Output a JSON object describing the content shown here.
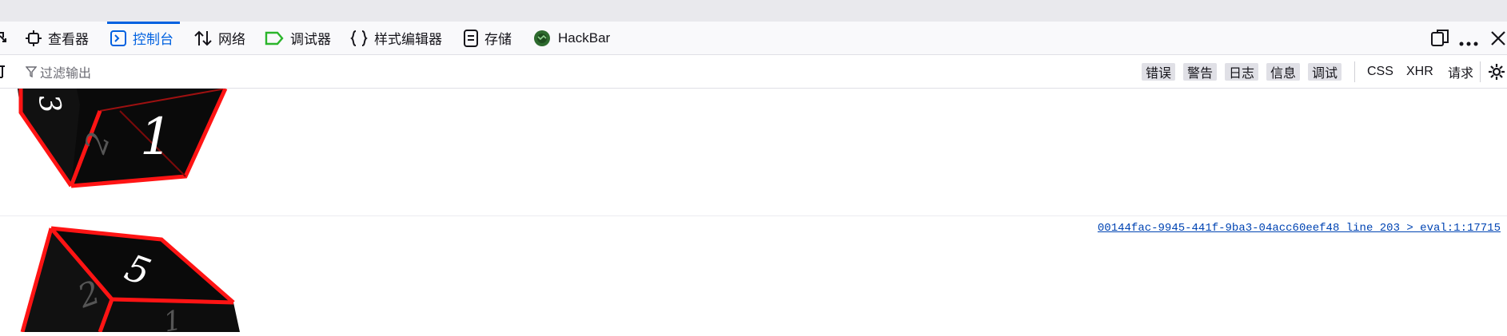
{
  "toolbar": {
    "tabs": [
      {
        "label": "查看器",
        "icon": "inspector-icon"
      },
      {
        "label": "控制台",
        "icon": "console-icon",
        "active": true
      },
      {
        "label": "网络",
        "icon": "network-icon"
      },
      {
        "label": "调试器",
        "icon": "debugger-icon"
      },
      {
        "label": "样式编辑器",
        "icon": "style-editor-icon"
      },
      {
        "label": "存储",
        "icon": "storage-icon"
      },
      {
        "label": "HackBar",
        "icon": "hackbar-icon"
      }
    ],
    "active_color": "#0061e0"
  },
  "filterbar": {
    "placeholder": "过滤输出",
    "levels": [
      "错误",
      "警告",
      "日志",
      "信息",
      "调试"
    ],
    "types": [
      "CSS",
      "XHR",
      "请求"
    ]
  },
  "console": {
    "messages": [
      {
        "kind": "image",
        "dice_faces": [
          "1",
          "2",
          "3"
        ]
      },
      {
        "kind": "image",
        "source": "00144fac-9945-441f-9ba3-04acc60eef48 line 203 > eval:1:17715",
        "dice_faces": [
          "5",
          "2",
          "1"
        ]
      }
    ]
  }
}
